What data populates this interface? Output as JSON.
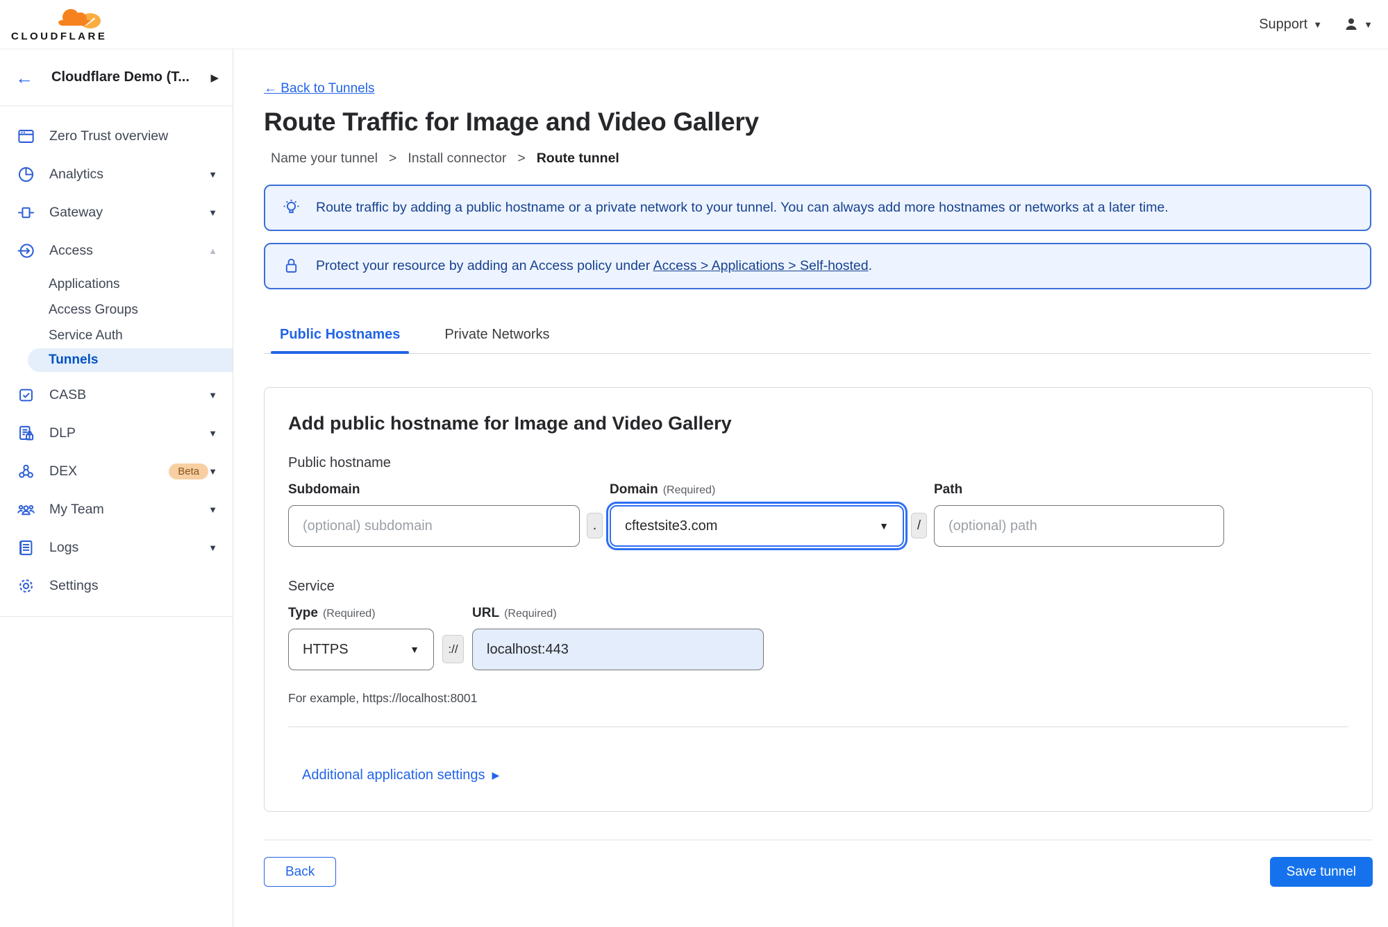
{
  "colors": {
    "accent_blue": "#2264e8",
    "selected_nav_text": "#0051c3",
    "selected_nav_bg": "#e4effb",
    "banner_bg": "#edf4ff",
    "banner_border": "#3a6fd8",
    "banner_text": "#17418f",
    "save_button_bg": "#1672ec",
    "cloudflare_orange": "#f6821f",
    "cloudflare_orange_light": "#fbad41",
    "beta_badge_bg": "#f7cfa2"
  },
  "icons": {
    "chevron_down": "▼",
    "chevron_up": "▲",
    "chevron_right": "▶",
    "back_arrow": "←",
    "select_arrow": "▼"
  },
  "topbar": {
    "logo_text": "CLOUDFLARE",
    "support_label": "Support"
  },
  "sidebar": {
    "account_label": "Cloudflare Demo (T...",
    "items": [
      {
        "label": "Zero Trust overview"
      },
      {
        "label": "Analytics"
      },
      {
        "label": "Gateway"
      },
      {
        "label": "Access"
      },
      {
        "label": "CASB"
      },
      {
        "label": "DLP"
      },
      {
        "label": "DEX",
        "badge": "Beta"
      },
      {
        "label": "My Team"
      },
      {
        "label": "Logs"
      },
      {
        "label": "Settings"
      }
    ],
    "access_subitems": [
      {
        "label": "Applications"
      },
      {
        "label": "Access Groups"
      },
      {
        "label": "Service Auth"
      },
      {
        "label": "Tunnels"
      }
    ]
  },
  "main": {
    "back_link": "← Back to Tunnels",
    "page_title": "Route Traffic for Image and Video Gallery",
    "steps": {
      "step1": "Name your tunnel",
      "separator": ">",
      "step2": "Install connector",
      "step3": "Route tunnel"
    },
    "banner_tip_text": "Route traffic by adding a public hostname or a private network to your tunnel. You can always add more hostnames or networks at a later time.",
    "banner_protect_prefix": "Protect your resource by adding an Access policy under",
    "banner_protect_link": "Access > Applications > Self-hosted",
    "banner_protect_suffix": ".",
    "tabs": {
      "public_hostnames": "Public Hostnames",
      "private_networks": "Private Networks"
    },
    "form": {
      "title": "Add public hostname for Image and Video Gallery",
      "public_hostname_section": "Public hostname",
      "subdomain_label": "Subdomain",
      "subdomain_placeholder": "(optional) subdomain",
      "dot_separator": ".",
      "domain_label": "Domain",
      "required_hint": "(Required)",
      "domain_value": "cftestsite3.com",
      "slash_separator": "/",
      "path_label": "Path",
      "path_placeholder": "(optional) path",
      "service_section": "Service",
      "type_label": "Type",
      "type_value": "HTTPS",
      "scheme_separator": "://",
      "url_label": "URL",
      "url_value": "localhost:443",
      "example_hint": "For example, https://localhost:8001",
      "additional_settings_label": "Additional application settings"
    },
    "footer": {
      "back_label": "Back",
      "save_label": "Save tunnel"
    }
  }
}
